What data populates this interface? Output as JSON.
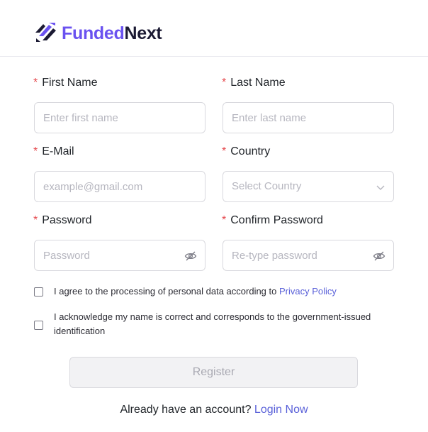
{
  "brand": {
    "part1": "Funded",
    "part2": "Next",
    "icon": "fundednext-logo-icon"
  },
  "form": {
    "required_mark": "*",
    "first_name": {
      "label": "First Name",
      "placeholder": "Enter first name"
    },
    "last_name": {
      "label": "Last Name",
      "placeholder": "Enter last name"
    },
    "email": {
      "label": "E-Mail",
      "placeholder": "example@gmail.com"
    },
    "country": {
      "label": "Country",
      "selected": "Select Country",
      "icon": "chevron-down-icon"
    },
    "password": {
      "label": "Password",
      "placeholder": "Password",
      "icon": "eye-off-icon"
    },
    "confirm_password": {
      "label": "Confirm Password",
      "placeholder": "Re-type password",
      "icon": "eye-off-icon"
    }
  },
  "consents": {
    "privacy_text": "I agree to the processing of personal data according to ",
    "privacy_link": "Privacy Policy",
    "privacy_checked": false,
    "identity_text": "I acknowledge my name is correct and corresponds to the government-issued identification",
    "identity_checked": false
  },
  "actions": {
    "register_label": "Register"
  },
  "footer": {
    "prompt": "Already have an account? ",
    "login_link": "Login Now"
  },
  "colors": {
    "brand_primary": "#6a52f0",
    "brand_dark": "#1b1a33",
    "link": "#5b62d9",
    "required": "#e5484d"
  }
}
